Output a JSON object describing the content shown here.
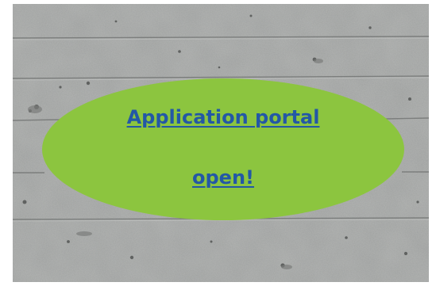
{
  "banner": {
    "link_line_1": "Application portal ",
    "link_line_2": "open!",
    "ellipse_color": "#8cc53f",
    "link_color": "#2358a6",
    "background": "concrete-wall-texture"
  }
}
